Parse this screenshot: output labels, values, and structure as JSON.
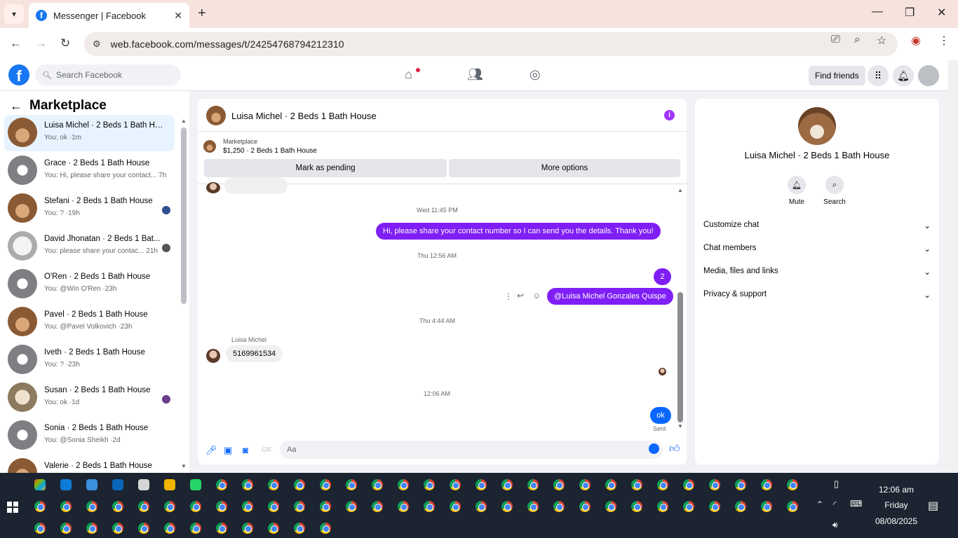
{
  "browser": {
    "tab_title": "Messenger | Facebook",
    "url": "web.facebook.com/messages/t/24254768794212310"
  },
  "fb": {
    "search_placeholder": "Search Facebook",
    "find_friends": "Find friends"
  },
  "sidebar": {
    "title": "Marketplace",
    "conversations": [
      {
        "name": "Luisa Michel · 2 Beds 1 Bath Hou...",
        "snippet": "You: ok ·1m",
        "thumb": "wood"
      },
      {
        "name": "Grace · 2 Beds 1 Bath House",
        "snippet": "You: Hi, please share your contact... 7h",
        "thumb": "gray"
      },
      {
        "name": "Stefani · 2 Beds 1 Bath House",
        "snippet": "You: ? ·19h",
        "thumb": "wood"
      },
      {
        "name": "David Jhonatan · 2 Beds 1 Bat...",
        "snippet": "You: please share your contac... 21h",
        "thumb": "light"
      },
      {
        "name": "O'Ren · 2 Beds 1 Bath House",
        "snippet": "You: @Win O'Ren ·23h",
        "thumb": "gray"
      },
      {
        "name": "Pavel · 2 Beds 1 Bath House",
        "snippet": "You: @Pavel Volkovich ·23h",
        "thumb": "wood"
      },
      {
        "name": "Iveth · 2 Beds 1 Bath House",
        "snippet": "You: ? ·23h",
        "thumb": "gray"
      },
      {
        "name": "Susan · 2 Beds 1 Bath House",
        "snippet": "You: ok ·1d",
        "thumb": "beige"
      },
      {
        "name": "Sonia · 2 Beds 1 Bath House",
        "snippet": "You: @Sonia Sheikh ·2d",
        "thumb": "gray"
      },
      {
        "name": "Valerie · 2 Beds 1 Bath House",
        "snippet": "",
        "thumb": "wood"
      }
    ]
  },
  "chat": {
    "title": "Luisa Michel · 2 Beds 1 Bath House",
    "marketplace_label": "Marketplace",
    "listing": "$1,250 · 2 Beds 1 Bath House",
    "mark_pending": "Mark as pending",
    "more_options": "More options",
    "stamp1": "Wed 11:45 PM",
    "msg1": "Hi, please share your contact number so I can send you the details. Thank you!",
    "stamp2": "Thu 12:56 AM",
    "msg2": "2",
    "msg3": "@Luisa Michel Gonzales Quispe",
    "stamp3": "Thu 4:44 AM",
    "sender": "Luisa Michel",
    "msg4": "5169961534",
    "stamp4": "12:06 AM",
    "msg5": "ok",
    "sent": "Sent",
    "composer_placeholder": "Aa"
  },
  "info": {
    "name": "Luisa Michel · 2 Beds 1 Bath House",
    "mute": "Mute",
    "search": "Search",
    "rows": [
      "Customize chat",
      "Chat members",
      "Media, files and links",
      "Privacy & support"
    ]
  },
  "taskbar": {
    "time": "12:06 am",
    "day": "Friday",
    "date": "08/08/2025"
  },
  "colors": {
    "accent_purple": "#7f1ff5",
    "fb_blue": "#1877f2"
  }
}
